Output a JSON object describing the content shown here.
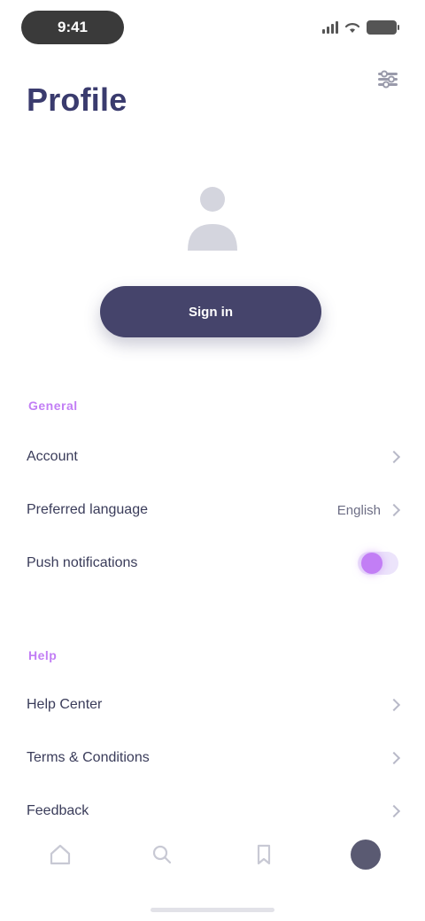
{
  "status_bar": {
    "time": "9:41"
  },
  "header": {
    "title": "Profile",
    "settings_icon": "gear-icon"
  },
  "account": {
    "avatar_icon": "user-icon",
    "sign_in_label": "Sign in"
  },
  "sections": [
    {
      "title": "General",
      "rows": [
        {
          "label": "Account",
          "value": "",
          "control": "chevron"
        },
        {
          "label": "Preferred language",
          "value": "English",
          "control": "chevron"
        },
        {
          "label": "Push notifications",
          "value": "",
          "control": "toggle"
        }
      ]
    },
    {
      "title": "Help",
      "rows": [
        {
          "label": "Help Center",
          "value": "",
          "control": "chevron"
        },
        {
          "label": "Terms & Conditions",
          "value": "",
          "control": "chevron"
        },
        {
          "label": "Feedback",
          "value": "",
          "control": "chevron"
        }
      ]
    }
  ],
  "toggles": {
    "push_notifications_on": true
  },
  "nav": {
    "items": [
      {
        "icon": "home-icon"
      },
      {
        "icon": "search-icon"
      },
      {
        "icon": "bookmark-icon"
      },
      {
        "icon": "profile-icon",
        "active": true
      }
    ]
  },
  "colors": {
    "accent": "#c27ef5",
    "primary": "#45446b",
    "title": "#3a3b6e"
  }
}
